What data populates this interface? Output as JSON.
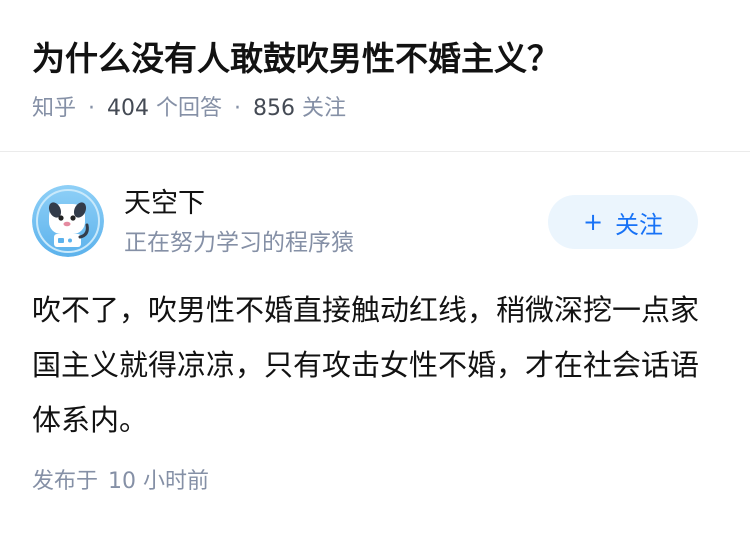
{
  "question": {
    "title": "为什么没有人敢鼓吹男性不婚主义？",
    "source": "知乎",
    "answer_count": "404",
    "answer_count_label": "个回答",
    "follower_count": "856",
    "follower_label": "关注",
    "separator": "·"
  },
  "author": {
    "name": "天空下",
    "bio": "正在努力学习的程序猿",
    "avatar_icon": "robot-avatar-icon",
    "follow_plus": "+",
    "follow_label": "关注"
  },
  "answer": {
    "content": "吹不了，吹男性不婚直接触动红线，稍微深挖一点家国主义就得凉凉，只有攻击女性不婚，才在社会话语体系内。",
    "published_label": "发布于",
    "published_time": "10 小时前"
  },
  "colors": {
    "title": "#121212",
    "meta": "#8590a6",
    "accent": "#1772f6",
    "follow_bg": "#ebf5fd",
    "divider": "#ebebeb"
  }
}
